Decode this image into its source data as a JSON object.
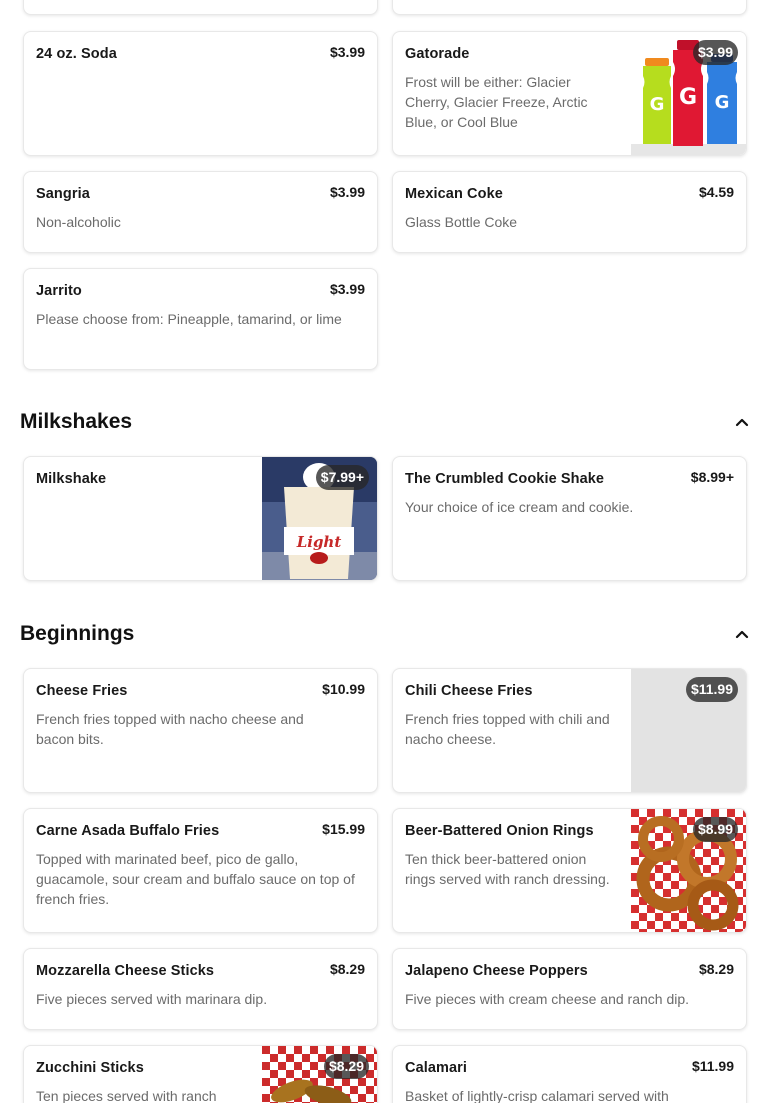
{
  "drinks": {
    "items": [
      {
        "name": "24 oz. Soda",
        "desc": "",
        "price": "$3.99"
      },
      {
        "name": "Gatorade",
        "desc": "Frost will be either: Glacier Cherry, Glacier Freeze, Arctic Blue, or Cool Blue",
        "price": "$3.99",
        "image_icon": "gatorade-bottles-image"
      },
      {
        "name": "Sangria",
        "desc": "Non-alcoholic",
        "price": "$3.99"
      },
      {
        "name": "Mexican Coke",
        "desc": "Glass Bottle Coke",
        "price": "$4.59"
      },
      {
        "name": "Jarrito",
        "desc": "Please choose from: Pineapple, tamarind, or lime",
        "price": "$3.99"
      }
    ]
  },
  "milkshakes": {
    "title": "Milkshakes",
    "items": [
      {
        "name": "Milkshake",
        "desc": "",
        "price": "$7.99+",
        "image_icon": "milkshake-cup-image"
      },
      {
        "name": "The Crumbled Cookie Shake",
        "desc": "Your choice of ice cream and cookie.",
        "price": "$8.99+"
      }
    ]
  },
  "beginnings": {
    "title": "Beginnings",
    "items": [
      {
        "name": "Cheese Fries",
        "desc": "French fries topped with nacho cheese and bacon bits.",
        "price": "$10.99"
      },
      {
        "name": "Chili Cheese Fries",
        "desc": "French fries topped with chili and nacho cheese.",
        "price": "$11.99",
        "image_icon": "placeholder-image"
      },
      {
        "name": "Carne Asada Buffalo Fries",
        "desc": "Topped with marinated beef, pico de gallo, guacamole, sour cream and buffalo sauce on top of french fries.",
        "price": "$15.99"
      },
      {
        "name": "Beer-Battered Onion Rings",
        "desc": "Ten thick beer-battered onion rings served with ranch dressing.",
        "price": "$8.99",
        "image_icon": "onion-rings-image"
      },
      {
        "name": "Mozzarella Cheese Sticks",
        "desc": "Five pieces served with marinara dip.",
        "price": "$8.29"
      },
      {
        "name": "Jalapeno Cheese Poppers",
        "desc": "Five pieces with cream cheese and ranch dip.",
        "price": "$8.29"
      },
      {
        "name": "Zucchini Sticks",
        "desc": "Ten pieces served with ranch",
        "price": "$8.29",
        "image_icon": "zucchini-sticks-image"
      },
      {
        "name": "Calamari",
        "desc": "Basket of lightly-crisp calamari served with",
        "price": "$11.99"
      }
    ]
  },
  "icons": {
    "collapse": "chevron-up-icon"
  },
  "colors": {
    "text": "#191919",
    "muted": "#6b6b6b",
    "border": "#e8e8e8",
    "pill": "#3a3a3a"
  }
}
